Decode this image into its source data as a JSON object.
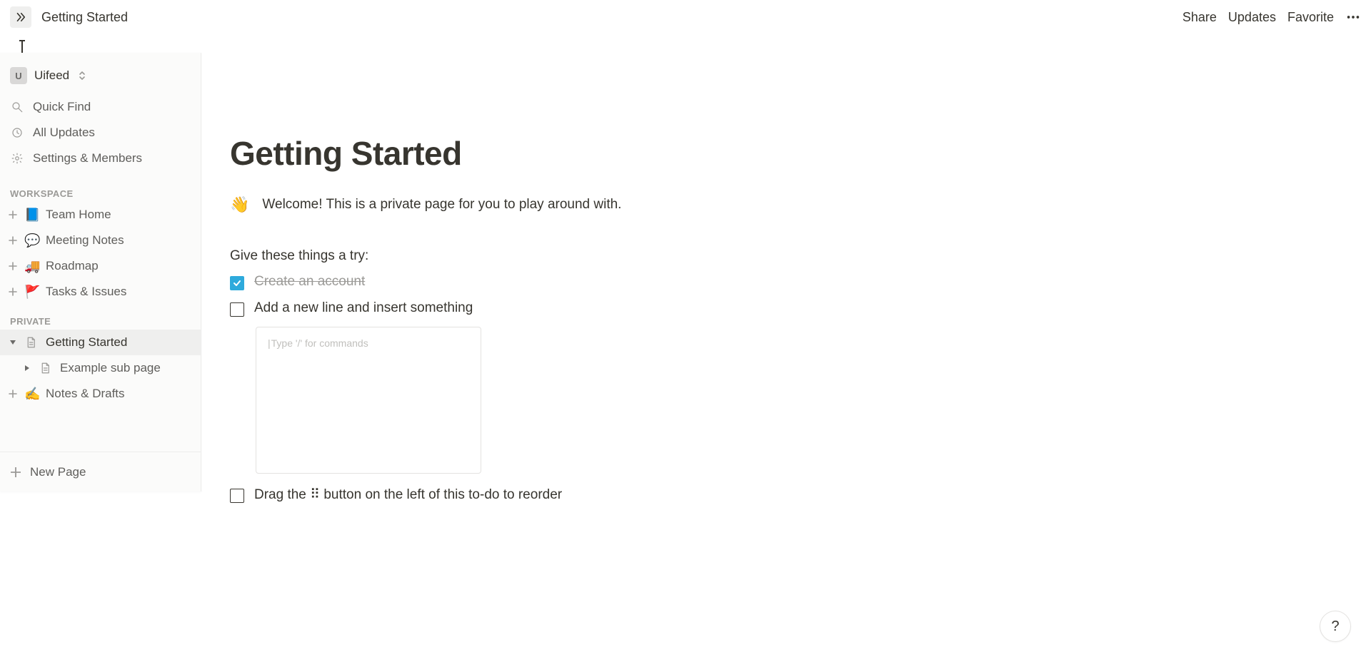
{
  "topbar": {
    "breadcrumb": "Getting Started",
    "share": "Share",
    "updates": "Updates",
    "favorite": "Favorite"
  },
  "sidebar": {
    "workspace_initial": "U",
    "workspace_name": "Uifeed",
    "quick_find": "Quick Find",
    "all_updates": "All Updates",
    "settings": "Settings & Members",
    "section_workspace": "WORKSPACE",
    "section_private": "PRIVATE",
    "ws_items": [
      {
        "emoji": "📘",
        "label": "Team Home"
      },
      {
        "emoji": "💬",
        "label": "Meeting Notes"
      },
      {
        "emoji": "🚚",
        "label": "Roadmap"
      },
      {
        "emoji": "🚩",
        "label": "Tasks & Issues"
      }
    ],
    "private_items": [
      {
        "emoji": "📄",
        "label": "Getting Started",
        "expanded": true,
        "active": true
      },
      {
        "emoji": "📄",
        "label": "Example sub page",
        "sub": true
      },
      {
        "emoji": "✍️",
        "label": "Notes & Drafts"
      }
    ],
    "new_page": "New Page"
  },
  "doc": {
    "title": "Getting Started",
    "wave_emoji": "👋",
    "welcome": "Welcome! This is a private page for you to play around with.",
    "try_heading": "Give these things a try:",
    "todos": [
      {
        "label": "Create an account",
        "checked": true
      },
      {
        "label": "Add a new line and insert something",
        "checked": false
      },
      {
        "label": "Drag the ⠿ button on the left of this to-do to reorder",
        "checked": false
      }
    ],
    "embed_placeholder": "Type '/' for commands"
  },
  "help": "?"
}
